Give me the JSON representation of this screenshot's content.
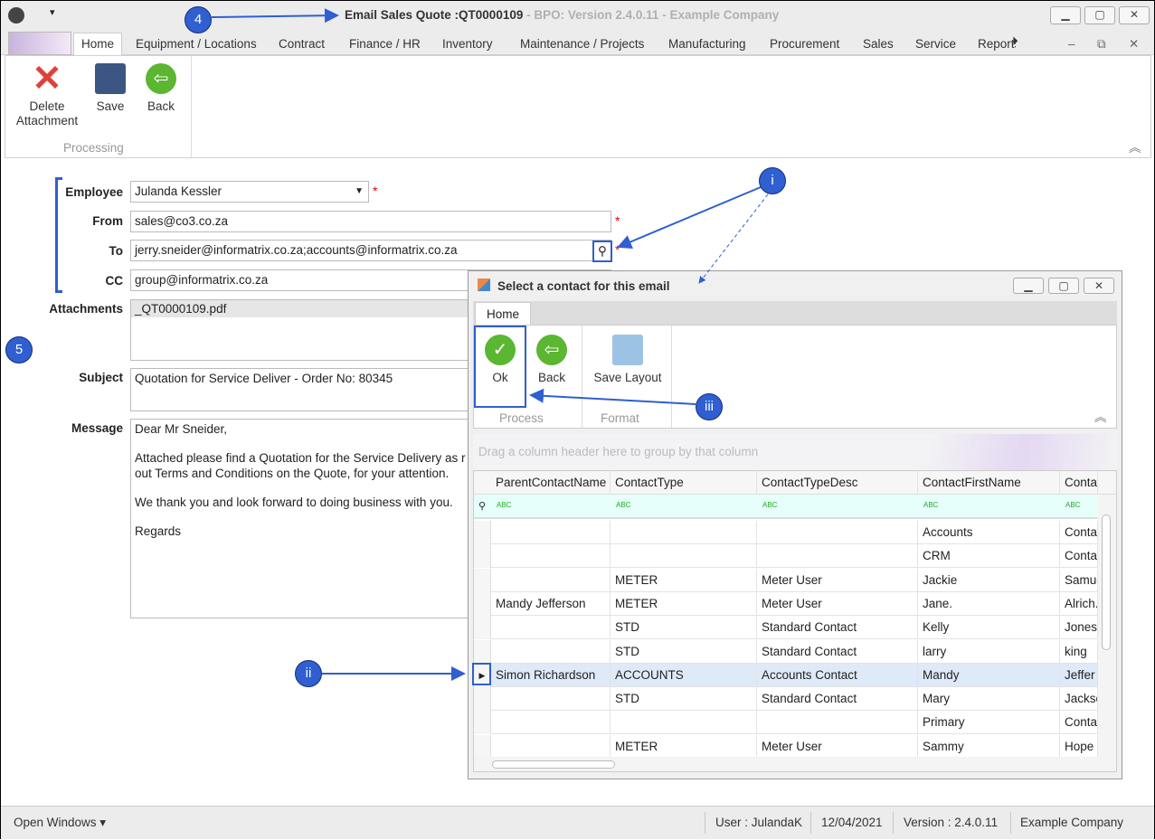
{
  "window": {
    "title": "Email Sales Quote :QT0000109",
    "title_suffix": "- BPO: Version 2.4.0.11 - Example Company"
  },
  "tabs": [
    "Home",
    "Equipment / Locations",
    "Contract",
    "Finance / HR",
    "Inventory",
    "Maintenance / Projects",
    "Manufacturing",
    "Procurement",
    "Sales",
    "Service",
    "Reports"
  ],
  "ribbon": {
    "delete_label": "Delete Attachment",
    "save_label": "Save",
    "back_label": "Back",
    "group": "Processing"
  },
  "form": {
    "employee_label": "Employee",
    "employee": "Julanda Kessler",
    "from_label": "From",
    "from": "sales@co3.co.za",
    "to_label": "To",
    "to": "jerry.sneider@informatrix.co.za;accounts@informatrix.co.za",
    "cc_label": "CC",
    "cc": "group@informatrix.co.za",
    "attachments_label": "Attachments",
    "attachment": "_QT0000109.pdf",
    "subject_label": "Subject",
    "subject": "Quotation for Service Deliver - Order No: 80345",
    "message_label": "Message",
    "message": [
      "Dear Mr Sneider,",
      "",
      "Attached please find a Quotation for the Service Delivery as r",
      "out Terms and Conditions on the Quote, for your attention.",
      "",
      "We thank you and look forward to doing business with you.",
      "",
      "Regards"
    ]
  },
  "dialog": {
    "title": "Select a contact for this email",
    "tab": "Home",
    "ok_label": "Ok",
    "back_label": "Back",
    "save_layout_label": "Save Layout",
    "group_process": "Process",
    "group_format": "Format",
    "group_panel": "Drag a column header here to group by that column",
    "columns": [
      "ParentContactName",
      "ContactType",
      "ContactTypeDesc",
      "ContactFirstName",
      "ContactSu"
    ],
    "rows": [
      [
        "",
        "",
        "",
        "Accounts",
        "Conta"
      ],
      [
        "",
        "",
        "",
        "CRM",
        "Conta"
      ],
      [
        "",
        "METER",
        "Meter User",
        "Jackie",
        "Samue"
      ],
      [
        "Mandy Jefferson",
        "METER",
        "Meter User",
        "Jane.",
        "Alrich."
      ],
      [
        "",
        "STD",
        "Standard Contact",
        "Kelly",
        "Jones"
      ],
      [
        "",
        "STD",
        "Standard Contact",
        "larry",
        "king"
      ],
      [
        "Simon Richardson",
        "ACCOUNTS",
        "Accounts Contact",
        "Mandy",
        "Jeffer"
      ],
      [
        "",
        "STD",
        "Standard Contact",
        "Mary",
        "Jackso"
      ],
      [
        "",
        "",
        "",
        "Primary",
        "Conta"
      ],
      [
        "",
        "METER",
        "Meter User",
        "Sammy",
        "Hope"
      ]
    ],
    "selected_row": 6
  },
  "status": {
    "open_windows": "Open Windows ▾",
    "user": "User : JulandaK",
    "date": "12/04/2021",
    "version": "Version : 2.4.0.11",
    "company": "Example Company"
  },
  "annotations": {
    "a4": "4",
    "a5": "5",
    "ai": "i",
    "aii": "ii",
    "aiii": "iii"
  },
  "colors": {
    "accent": "#2f5fd0",
    "required": "#dd0000",
    "selected_row": "#dfeaf8",
    "filter_row": "#e6fffb"
  }
}
